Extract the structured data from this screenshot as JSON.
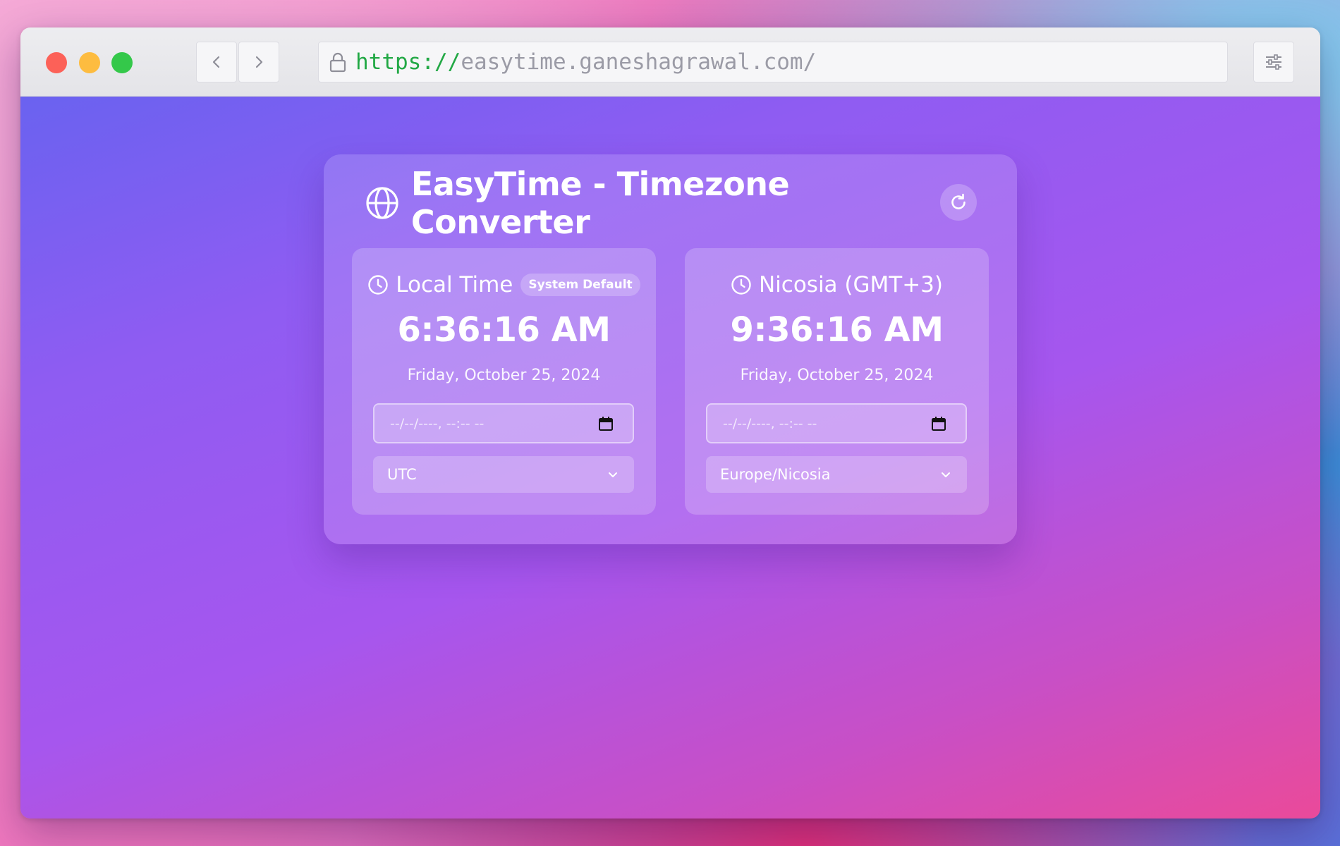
{
  "browser": {
    "url_scheme": "https://",
    "url_host": "easytime.ganeshagrawal.com/"
  },
  "app": {
    "title": "EasyTime - Timezone Converter"
  },
  "panels": [
    {
      "label": "Local Time",
      "badge": "System Default",
      "time": "6:36:16 AM",
      "date": "Friday, October 25, 2024",
      "datetime_placeholder": "--/--/----, --:-- --",
      "timezone": "UTC"
    },
    {
      "label": "Nicosia (GMT+3)",
      "time": "9:36:16 AM",
      "date": "Friday, October 25, 2024",
      "datetime_placeholder": "--/--/----, --:-- --",
      "timezone": "Europe/Nicosia"
    }
  ],
  "colors": {
    "close": "#fc6158",
    "minimize": "#fdbc40",
    "maximize": "#34c84a",
    "url_scheme": "#22a845"
  }
}
